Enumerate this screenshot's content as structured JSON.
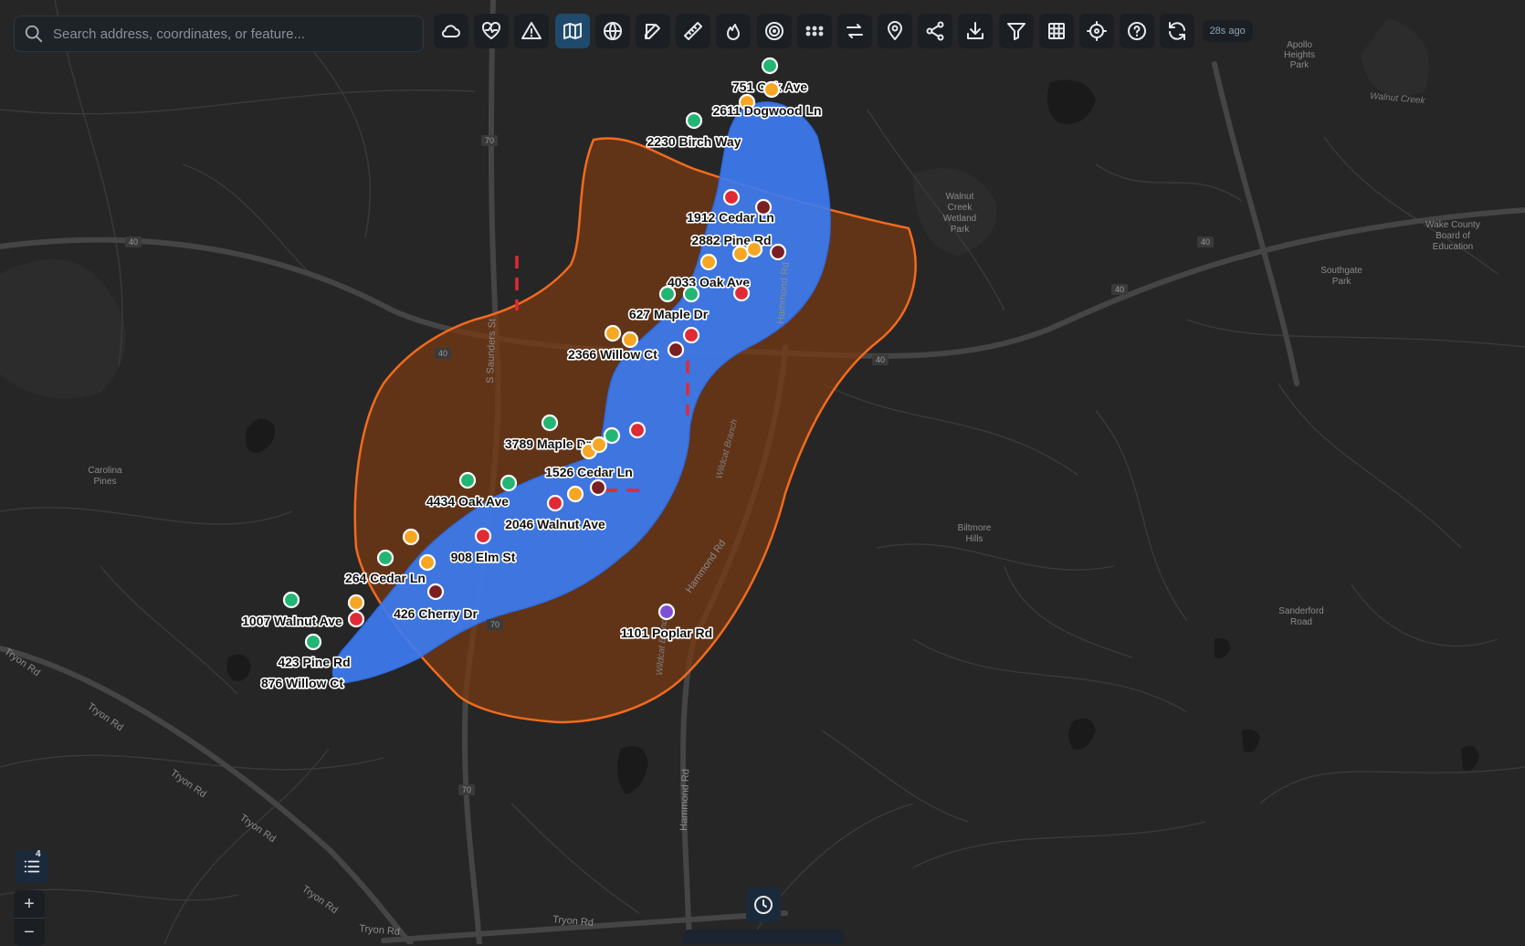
{
  "search": {
    "placeholder": "Search address, coordinates, or feature..."
  },
  "toolbar": {
    "tools": [
      {
        "icon": "cloud-icon",
        "active": false
      },
      {
        "icon": "heart-pulse-icon",
        "active": false
      },
      {
        "icon": "warning-icon",
        "active": false
      },
      {
        "icon": "map-icon",
        "active": true
      },
      {
        "icon": "globe-icon",
        "active": false
      },
      {
        "icon": "edit-icon",
        "active": false
      },
      {
        "icon": "ruler-icon",
        "active": false
      },
      {
        "icon": "flame-icon",
        "active": false
      },
      {
        "icon": "target-icon",
        "active": false
      },
      {
        "icon": "grid-dots-icon",
        "active": false
      },
      {
        "icon": "swap-icon",
        "active": false
      },
      {
        "icon": "map-pin-icon",
        "active": false
      },
      {
        "icon": "share-icon",
        "active": false
      },
      {
        "icon": "download-icon",
        "active": false
      },
      {
        "icon": "filter-icon",
        "active": false
      },
      {
        "icon": "table-icon",
        "active": false
      },
      {
        "icon": "crosshair-icon",
        "active": false
      },
      {
        "icon": "help-icon",
        "active": false
      },
      {
        "icon": "refresh-icon",
        "active": false
      }
    ],
    "updated": "28s ago"
  },
  "layers": {
    "count": "4"
  },
  "zoom": {
    "in": "+",
    "out": "−"
  },
  "colors": {
    "status_green": "#22b573",
    "status_orange": "#f5a623",
    "status_red": "#e02a35",
    "status_darkred": "#7a1f22",
    "status_purple": "#7b4fd6",
    "flood_zone_fill": "#3d7bf0",
    "impact_zone_stroke": "#f26b1d",
    "impact_zone_fill": "#7a3a12"
  },
  "markers": [
    {
      "status": "green",
      "label": ""
    },
    {
      "status": "orange",
      "label": "751 Oak Ave"
    },
    {
      "status": "orange",
      "label": "2611 Dogwood Ln"
    },
    {
      "status": "green",
      "label": "2230 Birch Way"
    },
    {
      "status": "red",
      "label": "1912 Cedar Ln"
    },
    {
      "status": "darkred",
      "label": ""
    },
    {
      "status": "orange",
      "label": "2882 Pine Rd"
    },
    {
      "status": "orange",
      "label": ""
    },
    {
      "status": "orange",
      "label": ""
    },
    {
      "status": "darkred",
      "label": ""
    },
    {
      "status": "green",
      "label": "4033 Oak Ave"
    },
    {
      "status": "green",
      "label": ""
    },
    {
      "status": "red",
      "label": ""
    },
    {
      "status": "orange",
      "label": "627 Maple Dr"
    },
    {
      "status": "orange",
      "label": ""
    },
    {
      "status": "red",
      "label": ""
    },
    {
      "status": "darkred",
      "label": "2366 Willow Ct"
    },
    {
      "status": "green",
      "label": "3789 Maple Dr"
    },
    {
      "status": "green",
      "label": ""
    },
    {
      "status": "red",
      "label": ""
    },
    {
      "status": "orange",
      "label": ""
    },
    {
      "status": "orange",
      "label": ""
    },
    {
      "status": "darkred",
      "label": "1526 Cedar Ln"
    },
    {
      "status": "orange",
      "label": ""
    },
    {
      "status": "green",
      "label": "4434 Oak Ave"
    },
    {
      "status": "green",
      "label": ""
    },
    {
      "status": "red",
      "label": "2046 Walnut Ave"
    },
    {
      "status": "orange",
      "label": ""
    },
    {
      "status": "red",
      "label": "908 Elm St"
    },
    {
      "status": "green",
      "label": "264 Cedar Ln"
    },
    {
      "status": "orange",
      "label": ""
    },
    {
      "status": "darkred",
      "label": "426 Cherry Dr"
    },
    {
      "status": "green",
      "label": ""
    },
    {
      "status": "orange",
      "label": ""
    },
    {
      "status": "red",
      "label": "1007 Walnut Ave"
    },
    {
      "status": "green",
      "label": "423 Pine Rd"
    },
    {
      "status": "none",
      "label": "876 Willow Ct"
    },
    {
      "status": "purple",
      "label": "1101 Poplar Rd"
    }
  ],
  "map_labels": {
    "apollo": [
      "Apollo",
      "Heights",
      "Park"
    ],
    "walnut_creek_water": "Walnut Creek",
    "walnut_creek_park": [
      "Walnut",
      "Creek",
      "Wetland",
      "Park"
    ],
    "wake_county": [
      "Wake County",
      "Board of",
      "Education"
    ],
    "southgate": [
      "Southgate",
      "Park"
    ],
    "carolina": [
      "Carolina",
      "Pines"
    ],
    "biltmore": [
      "Biltmore",
      "Hills"
    ],
    "sanderford": [
      "Sanderford",
      "Road"
    ],
    "tryon": "Tryon Rd",
    "hammond": "Hammond Rd",
    "saunders": "S Saunders St",
    "wildcat": "Wildcat Branch",
    "shield_40": "40",
    "shield_70": "70"
  }
}
